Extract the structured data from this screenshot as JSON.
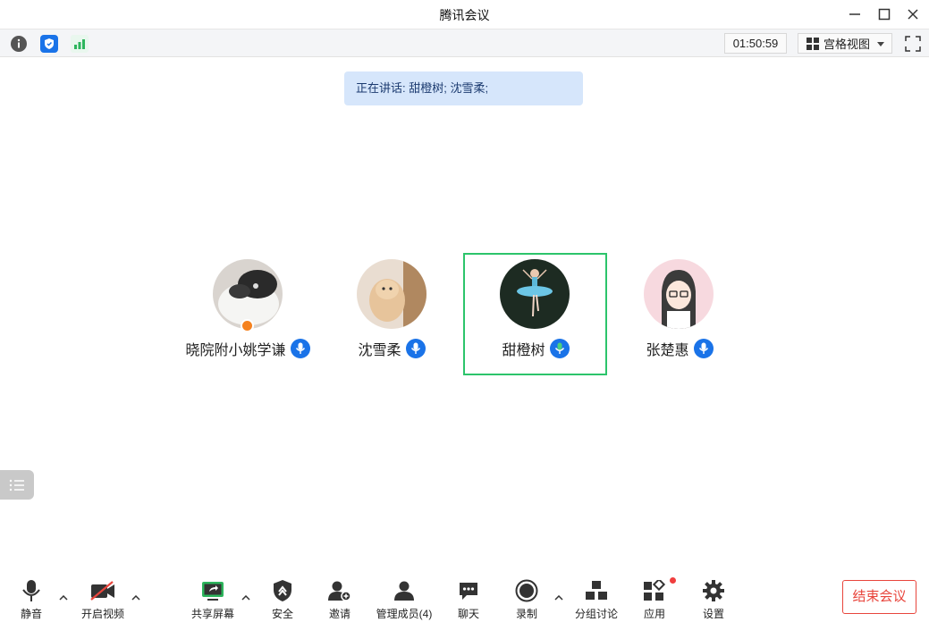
{
  "window": {
    "title": "腾讯会议"
  },
  "toolbar": {
    "timer": "01:50:59",
    "view_label": "宫格视图"
  },
  "speaking_banner": "正在讲话: 甜橙树; 沈雪柔;",
  "participants": [
    {
      "name": "晓院附小姚学谦"
    },
    {
      "name": "沈雪柔"
    },
    {
      "name": "甜橙树"
    },
    {
      "name": "张楚惠"
    }
  ],
  "bottom_bar": {
    "mute": "静音",
    "video": "开启视频",
    "share": "共享屏幕",
    "security": "安全",
    "invite": "邀请",
    "members": "管理成员(4)",
    "chat": "聊天",
    "record": "录制",
    "breakout": "分组讨论",
    "apps": "应用",
    "settings": "设置",
    "end_meeting": "结束会议"
  },
  "colors": {
    "accent_blue": "#1a73e8",
    "speaking_green": "#2cc46b",
    "end_red": "#e8453c"
  }
}
